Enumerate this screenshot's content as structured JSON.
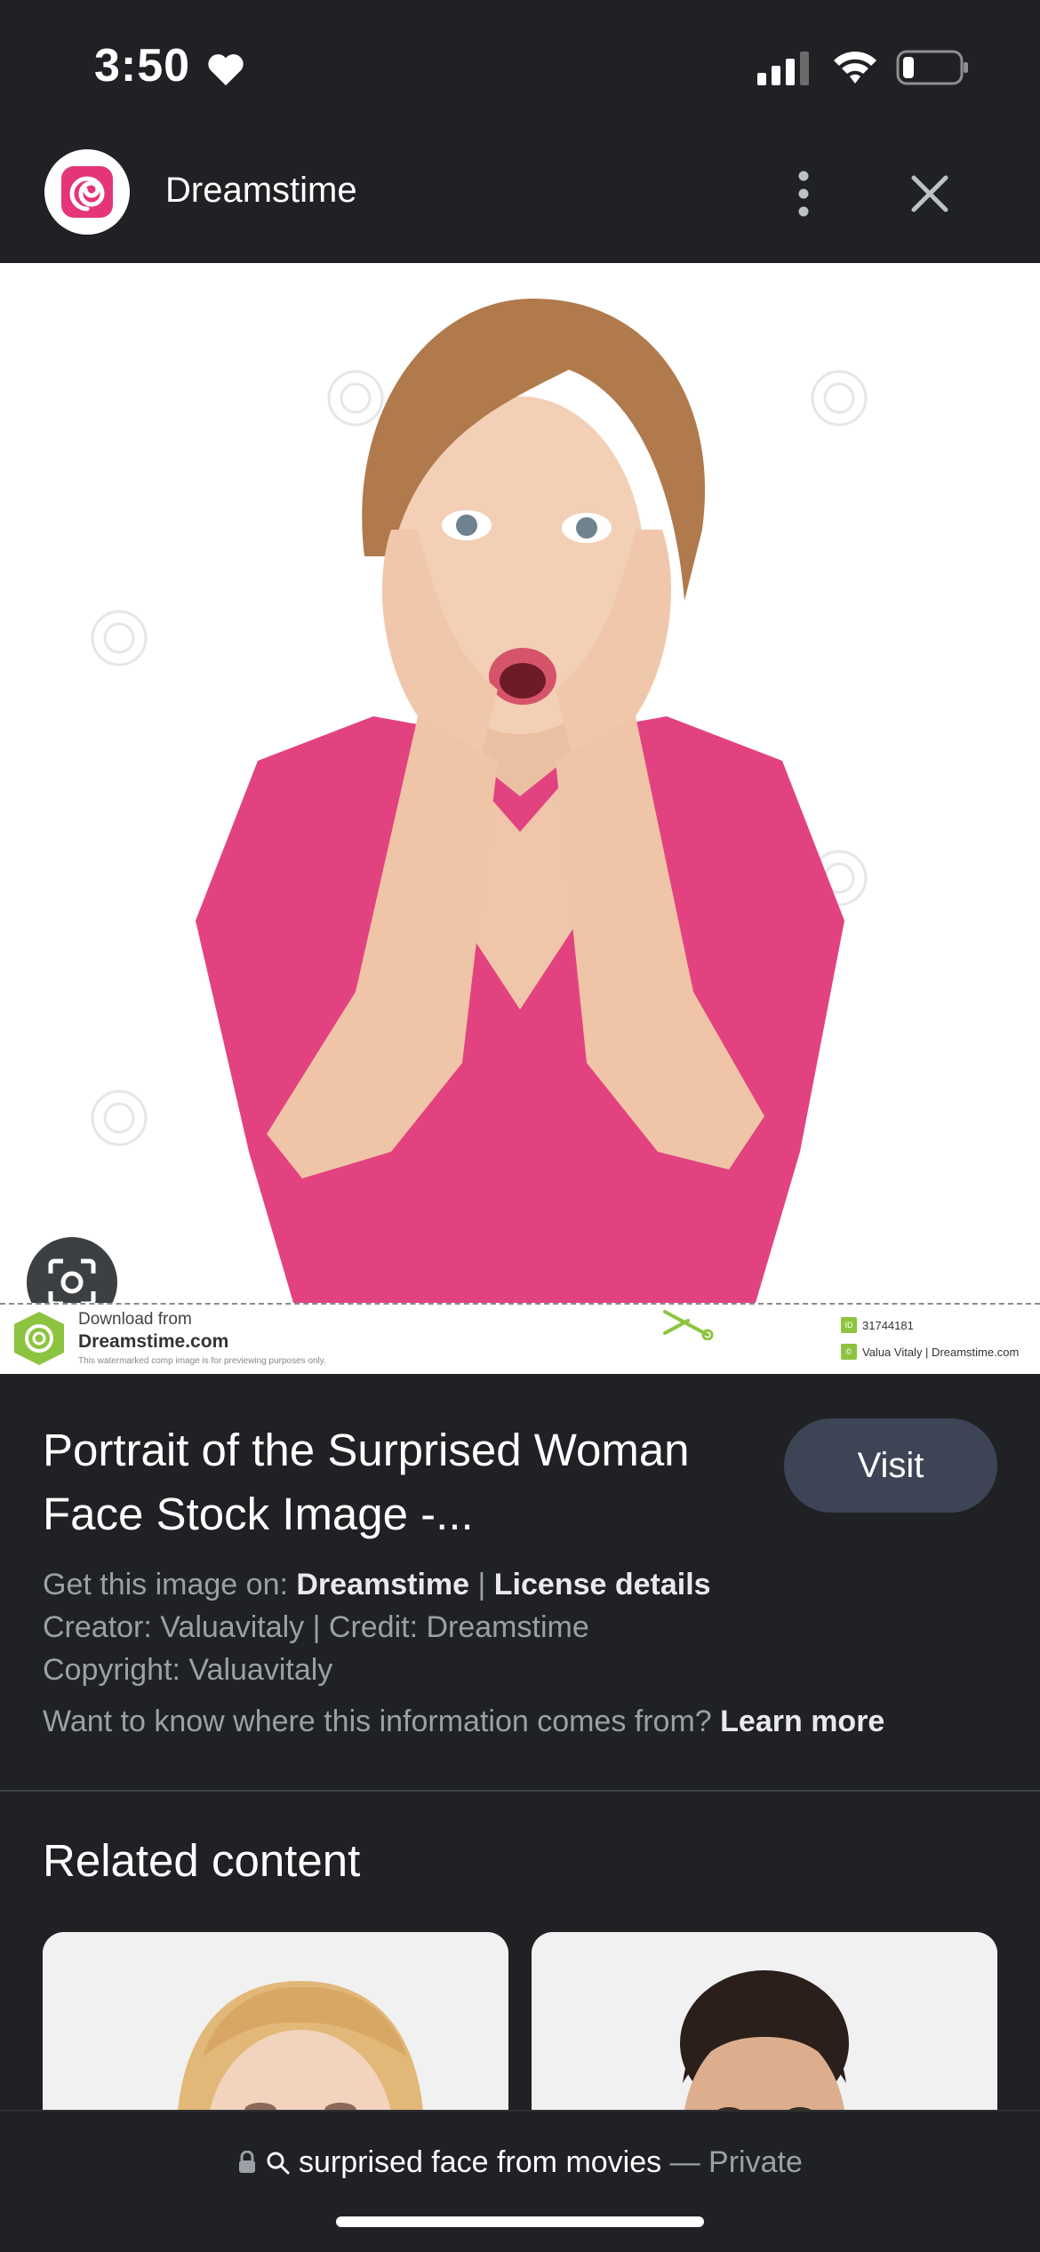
{
  "status_bar": {
    "time": "3:50"
  },
  "header": {
    "site_name": "Dreamstime"
  },
  "image": {
    "watermark_text": "dreamstime",
    "strip": {
      "download_from": "Download from",
      "site": "Dreamstime.com",
      "note": "This watermarked comp image is for previewing purposes only.",
      "id": "31744181",
      "credit": "Valua Vitaly | Dreamstime.com"
    }
  },
  "info": {
    "title": "Portrait of the Surprised Woman Face Stock Image -...",
    "visit_label": "Visit",
    "get_image_prefix": "Get this image on:",
    "get_image_site": "Dreamstime",
    "separator": "|",
    "license_label": "License details",
    "creator_line": "Creator: Valuavitaly | Credit: Dreamstime",
    "copyright_line": "Copyright: Valuavitaly",
    "info_question": "Want to know where this information comes from?",
    "learn_more": "Learn more"
  },
  "related": {
    "heading": "Related content"
  },
  "address_bar": {
    "query": "surprised face from movies",
    "suffix": "— Private"
  },
  "colors": {
    "background": "#202124",
    "visit_button": "#3c4456",
    "shirt": "#e24380",
    "brand_pink": "#e4357a"
  }
}
